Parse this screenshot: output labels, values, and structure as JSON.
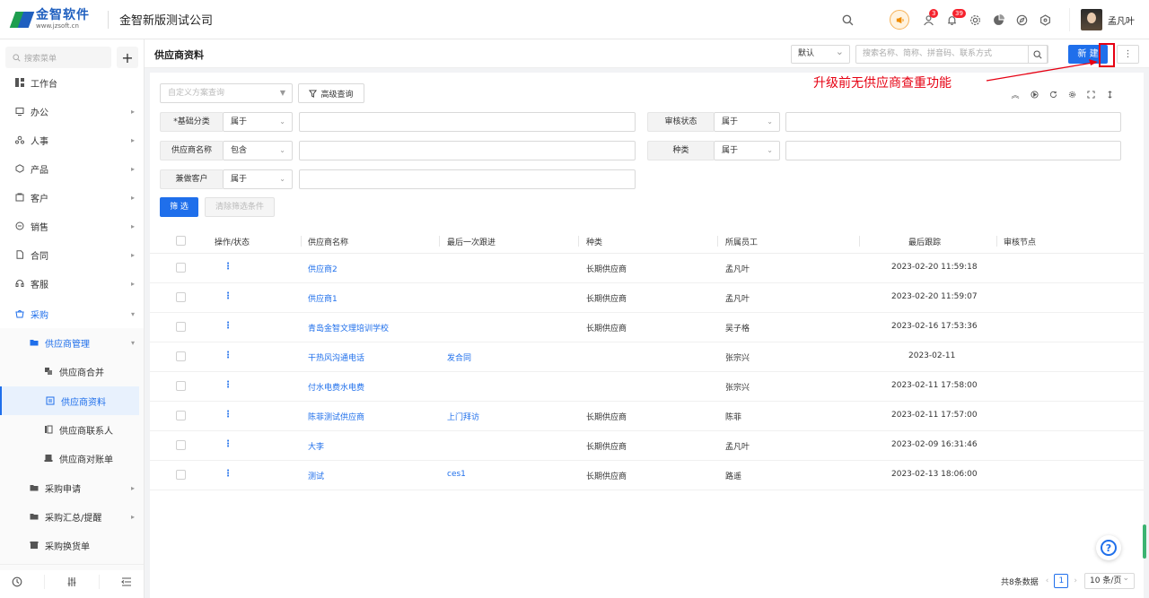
{
  "header": {
    "logo_text": "金智软件",
    "logo_url": "www.jzsoft.cn",
    "company": "金智新版测试公司",
    "badges": {
      "contacts": "3",
      "notifications": "39"
    },
    "user_name": "孟凡叶",
    "icons": [
      "search-icon",
      "broadcast-icon",
      "contacts-icon",
      "bell-icon",
      "settings-icon",
      "chart-icon",
      "compass-icon",
      "cube-icon"
    ]
  },
  "sidebar": {
    "search_placeholder": "搜索菜单",
    "add_label": "+",
    "items": [
      {
        "label": "工作台",
        "icon": "dashboard-icon"
      },
      {
        "label": "办公",
        "icon": "office-icon"
      },
      {
        "label": "人事",
        "icon": "people-icon"
      },
      {
        "label": "产品",
        "icon": "product-icon"
      },
      {
        "label": "客户",
        "icon": "customer-icon"
      },
      {
        "label": "销售",
        "icon": "sales-icon"
      },
      {
        "label": "合同",
        "icon": "contract-icon"
      },
      {
        "label": "客服",
        "icon": "service-icon"
      },
      {
        "label": "采购",
        "icon": "purchase-icon"
      },
      {
        "label": "供应商管理",
        "icon": "folder-icon"
      },
      {
        "label": "供应商合并",
        "icon": "merge-icon"
      },
      {
        "label": "供应商资料",
        "icon": "doc-icon"
      },
      {
        "label": "供应商联系人",
        "icon": "contact-card-icon"
      },
      {
        "label": "供应商对账单",
        "icon": "bill-icon"
      },
      {
        "label": "采购申请",
        "icon": "folder-icon"
      },
      {
        "label": "采购汇总/提醒",
        "icon": "folder-icon"
      },
      {
        "label": "采购换货单",
        "icon": "box-icon"
      }
    ]
  },
  "page": {
    "title": "供应商资料",
    "view_select": "默认",
    "search_placeholder": "搜索名称、简称、拼音码、联系方式",
    "new_label": "新 建",
    "more_label": "⋮",
    "annotation": "升级前无供应商查重功能"
  },
  "filters": {
    "scheme_placeholder": "自定义方案查询",
    "advanced_label": "高级查询",
    "fields": [
      {
        "label": "*基础分类",
        "op": "属于"
      },
      {
        "label": "审核状态",
        "op": "属于"
      },
      {
        "label": "供应商名称",
        "op": "包含"
      },
      {
        "label": "种类",
        "op": "属于"
      },
      {
        "label": "兼做客户",
        "op": "属于"
      }
    ],
    "filter_label": "筛 选",
    "clear_label": "清除筛选条件"
  },
  "table": {
    "columns": [
      "操作/状态",
      "供应商名称",
      "最后一次跟进",
      "种类",
      "所属员工",
      "最后跟踪",
      "审核节点"
    ],
    "rows": [
      {
        "name": "供应商2",
        "followup": "",
        "kind": "长期供应商",
        "staff": "孟凡叶",
        "last": "2023-02-20 11:59:18"
      },
      {
        "name": "供应商1",
        "followup": "",
        "kind": "长期供应商",
        "staff": "孟凡叶",
        "last": "2023-02-20 11:59:07"
      },
      {
        "name": "青岛金智文理培训学校",
        "followup": "",
        "kind": "长期供应商",
        "staff": "吴子格",
        "last": "2023-02-16 17:53:36"
      },
      {
        "name": "干热风沟通电话",
        "followup": "发合同",
        "kind": "",
        "staff": "张宗兴",
        "last": "2023-02-11"
      },
      {
        "name": "付水电费水电费",
        "followup": "",
        "kind": "",
        "staff": "张宗兴",
        "last": "2023-02-11 17:58:00"
      },
      {
        "name": "陈菲测试供应商",
        "followup": "上门拜访",
        "kind": "长期供应商",
        "staff": "陈菲",
        "last": "2023-02-11 17:57:00"
      },
      {
        "name": "大李",
        "followup": "",
        "kind": "长期供应商",
        "staff": "孟凡叶",
        "last": "2023-02-09 16:31:46"
      },
      {
        "name": "测试",
        "followup": "ces1",
        "kind": "长期供应商",
        "staff": "路遥",
        "last": "2023-02-13 18:06:00"
      }
    ]
  },
  "pager": {
    "total": "共8条数据",
    "page": "1",
    "page_size": "10 条/页"
  },
  "colors": {
    "accent": "#1f6feb",
    "annotation": "#e60012"
  }
}
